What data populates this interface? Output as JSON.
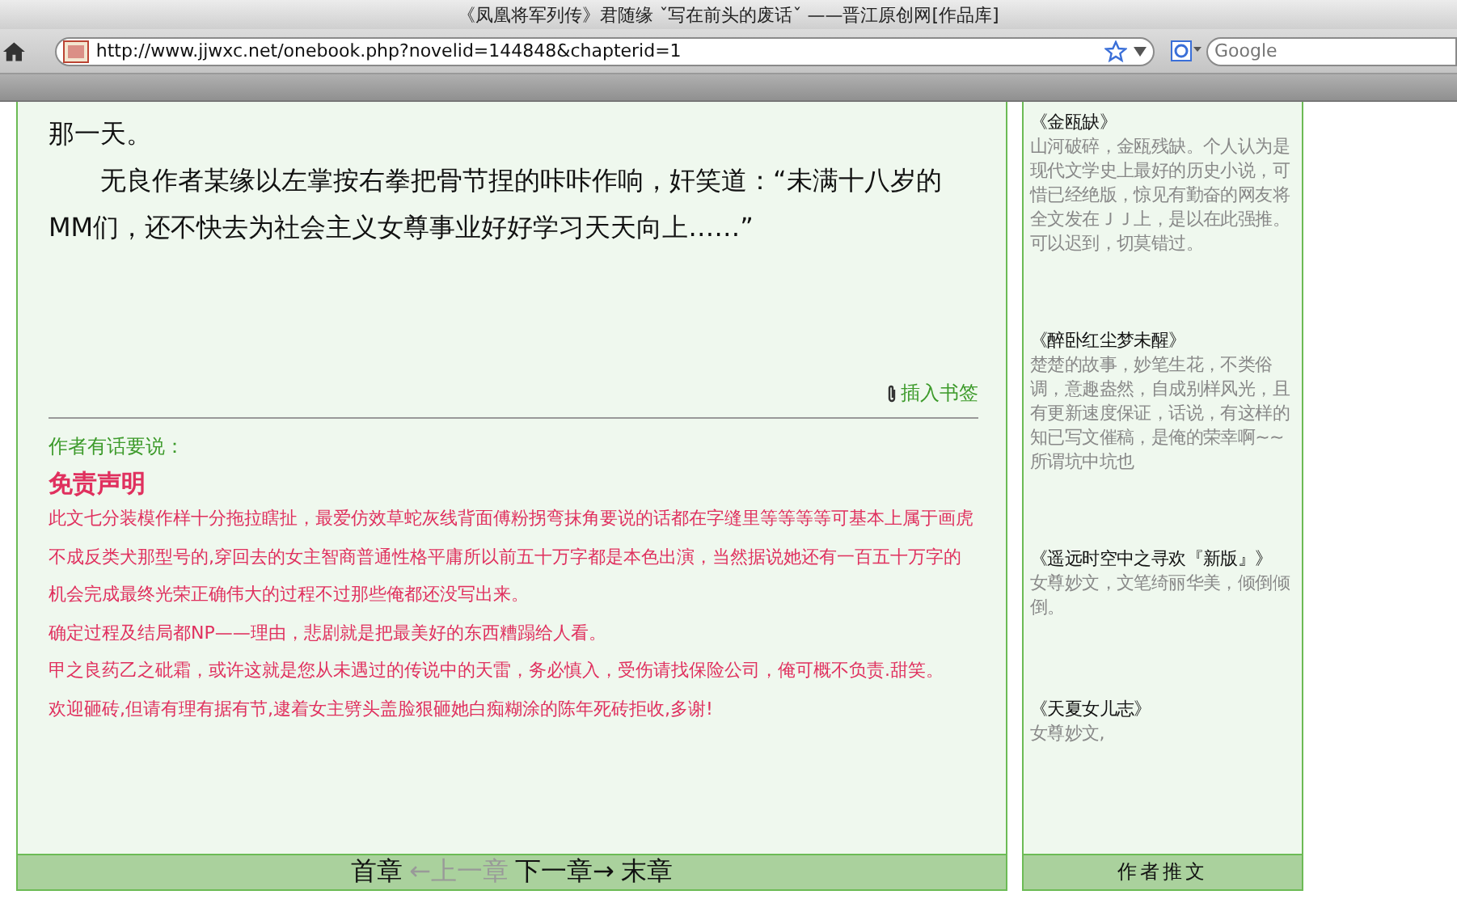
{
  "window": {
    "title": "《凤凰将军列传》君随缘 ˇ写在前头的废话ˇ ——晋江原创网[作品库]"
  },
  "toolbar": {
    "address": "http://www.jjwxc.net/onebook.php?novelid=144848&chapterid=1",
    "search": {
      "placeholder": "Google"
    }
  },
  "chapter": {
    "paragraphs": [
      {
        "kind": "continued",
        "text": "那一天。"
      },
      {
        "kind": "indented",
        "text": "无良作者某缘以左掌按右拳把骨节捏的咔咔作响，奸笑道：“未满十八岁的MM们，还不快去为社会主义女尊事业好好学习天天向上……”"
      }
    ],
    "bookmark": "插入书签",
    "note_label": "作者有话要说：",
    "note_title": "免责声明",
    "note_lines": [
      "此文七分装模作样十分拖拉瞎扯，最爱仿效草蛇灰线背面傅粉拐弯抹角要说的话都在字缝里等等等等可基本上属于画虎不成反类犬那型号的,穿回去的女主智商普通性格平庸所以前五十万字都是本色出演，当然据说她还有一百五十万字的机会完成最终光荣正确伟大的过程不过那些俺都还没写出来。",
      "确定过程及结局都NP——理由，悲剧就是把最美好的东西糟蹋给人看。",
      "甲之良药乙之砒霜，或许这就是您从未遇过的传说中的天雷，务必慎入，受伤请找保险公司，俺可概不负责.甜笑。",
      "欢迎砸砖,但请有理有据有节,逮着女主劈头盖脸狠砸她白痴糊涂的陈年死砖拒收,多谢!"
    ],
    "nav": [
      {
        "label": "首章",
        "disabled": false
      },
      {
        "label": "←上一章",
        "disabled": true
      },
      {
        "label": "下一章→",
        "disabled": false
      },
      {
        "label": "末章",
        "disabled": false
      }
    ]
  },
  "sidebar": {
    "items": [
      {
        "title": "《金瓯缺》",
        "description": "山河破碎，金瓯残缺。个人认为是现代文学史上最好的历史小说，可惜已经绝版，惊见有勤奋的网友将全文发在ＪＪ上，是以在此强推。可以迟到，切莫错过。"
      },
      {
        "title": "《醉卧红尘梦未醒》",
        "description": "楚楚的故事，妙笔生花，不类俗调，意趣盎然，自成别样风光，且有更新速度保证，话说，有这样的知已写文催稿，是俺的荣幸啊~~所谓坑中坑也"
      },
      {
        "title": "《遥远时空中之寻欢『新版』》",
        "description": "女尊妙文，文笔绮丽华美，倾倒倾倒。"
      },
      {
        "title": "《天夏女儿志》",
        "description": "女尊妙文,"
      }
    ],
    "footer": "作者推文"
  }
}
